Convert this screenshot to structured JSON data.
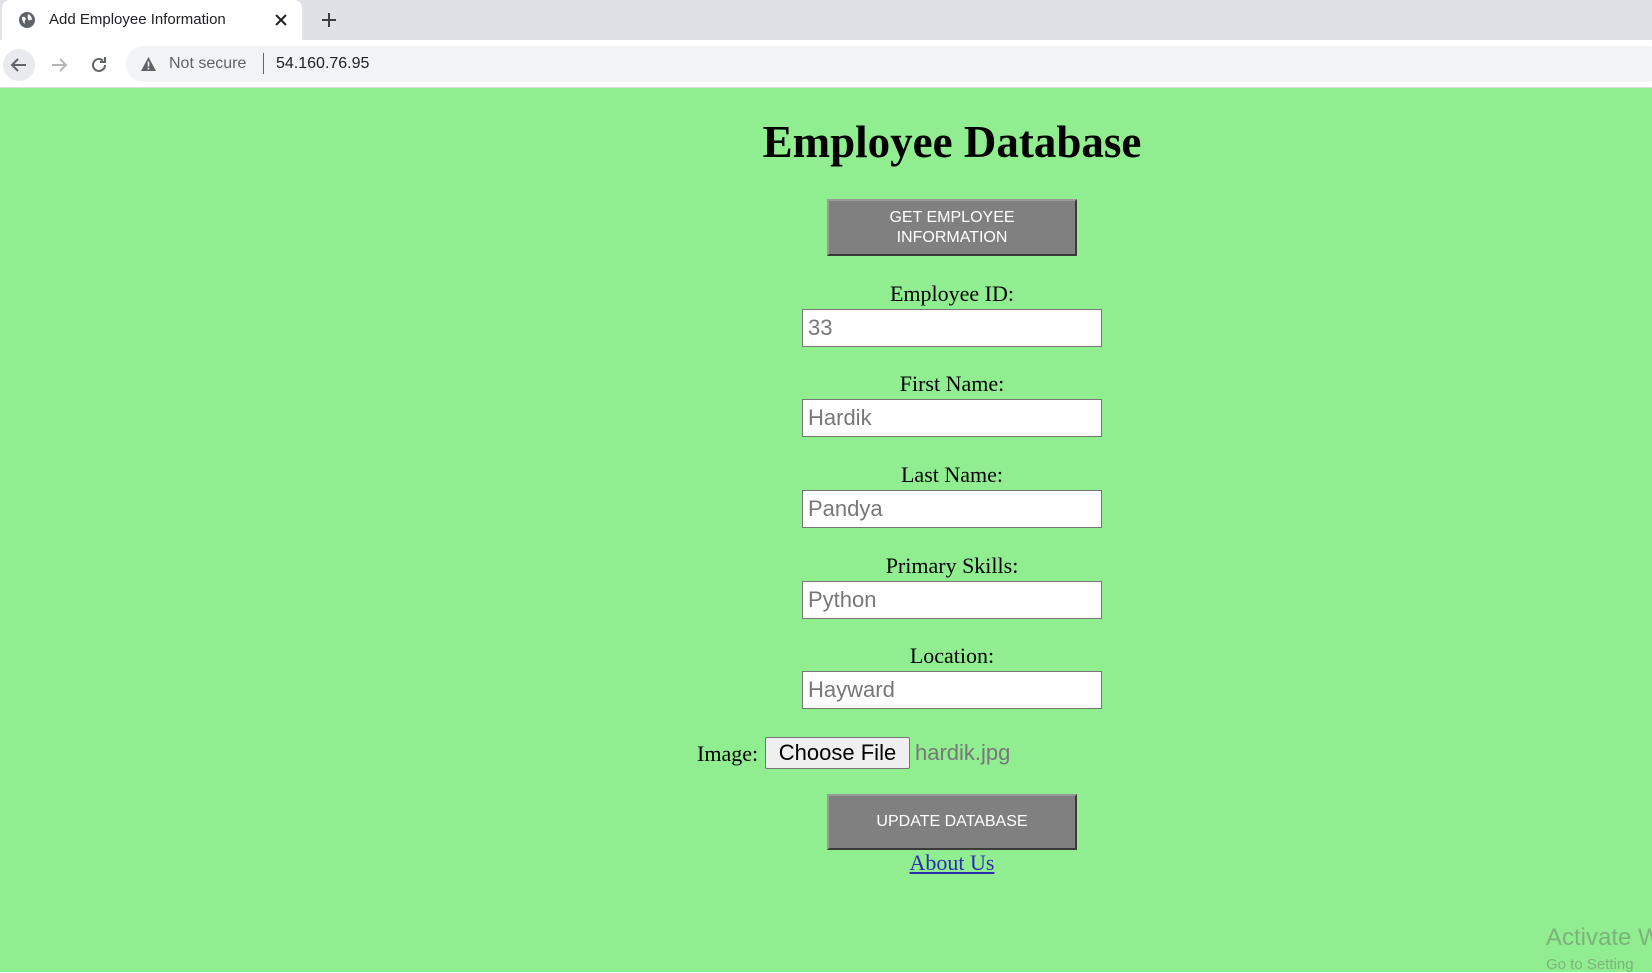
{
  "browser": {
    "tab_title": "Add Employee Information",
    "security_label": "Not secure",
    "url": "54.160.76.95"
  },
  "page": {
    "title": "Employee Database",
    "get_button_label": "GET EMPLOYEE INFORMATION",
    "fields": [
      {
        "label": "Employee ID:",
        "value": "33"
      },
      {
        "label": "First Name:",
        "value": "Hardik"
      },
      {
        "label": "Last Name:",
        "value": "Pandya"
      },
      {
        "label": "Primary Skills:",
        "value": "Python"
      },
      {
        "label": "Location:",
        "value": "Hayward"
      }
    ],
    "image_label": "Image:",
    "choose_file_label": "Choose File",
    "file_name": "hardik.jpg",
    "update_button_label": "UPDATE DATABASE",
    "about_link": "About Us"
  },
  "watermark": {
    "title": "Activate W",
    "subtitle": "Go to Setting"
  },
  "colors": {
    "page_background": "#90ee90",
    "button_background": "#808080"
  }
}
